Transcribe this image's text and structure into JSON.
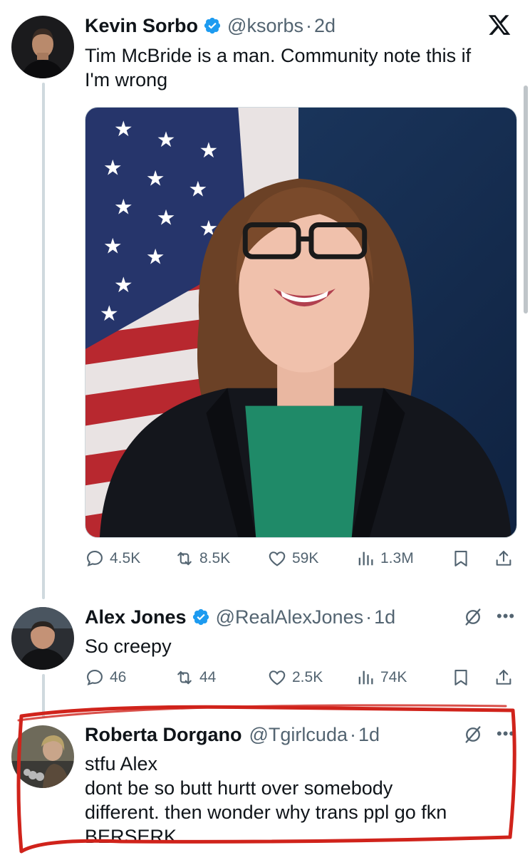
{
  "tweets": [
    {
      "name": "Kevin Sorbo",
      "verified": true,
      "handle": "@ksorbs",
      "separator": "·",
      "time": "2d",
      "text_lines": [
        "Tim McBride is a man. Community note this if",
        "I'm wrong"
      ],
      "metrics": {
        "replies": "4.5K",
        "reposts": "8.5K",
        "likes": "59K",
        "views": "1.3M"
      }
    },
    {
      "name": "Alex Jones",
      "verified": true,
      "handle": "@RealAlexJones",
      "separator": "·",
      "time": "1d",
      "text_lines": [
        "So creepy"
      ],
      "metrics": {
        "replies": "46",
        "reposts": "44",
        "likes": "2.5K",
        "views": "74K"
      }
    },
    {
      "name": "Roberta Dorgano",
      "verified": false,
      "handle": "@Tgirlcuda",
      "separator": "·",
      "time": "1d",
      "text_lines": [
        "stfu Alex",
        "dont be so butt hurtt over somebody",
        "different. then wonder why trans ppl go fkn",
        "BERSERK"
      ]
    }
  ],
  "icons": {
    "platform": "x-logo-icon",
    "verified": "verified-badge-icon",
    "reply": "reply-icon",
    "repost": "repost-icon",
    "like": "like-icon",
    "views": "views-icon",
    "bookmark": "bookmark-icon",
    "share": "share-icon",
    "grok": "grok-icon",
    "more": "more-icon"
  },
  "colors": {
    "verified_blue": "#1d9bf0",
    "text": "#0f1419",
    "muted": "#536471",
    "thread_line": "#cfd9de",
    "annotation_red": "#d0231b"
  }
}
